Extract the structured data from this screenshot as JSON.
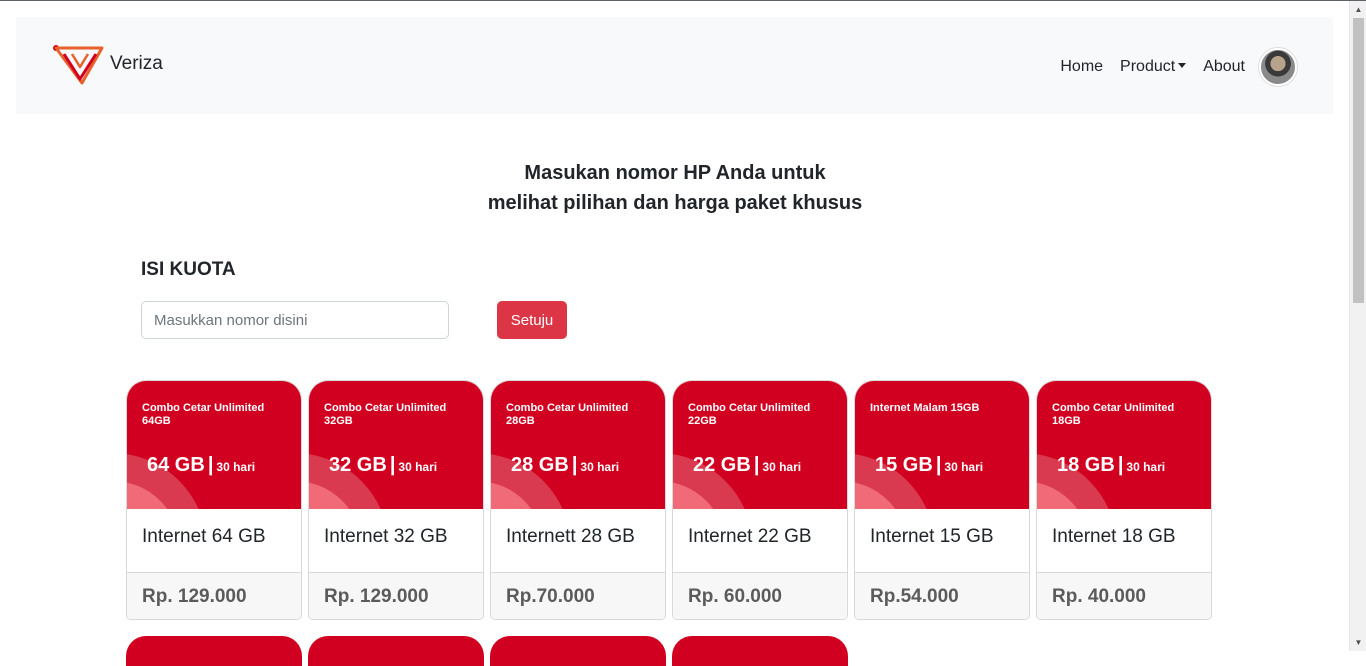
{
  "brand": {
    "name": "Veriza"
  },
  "nav": {
    "home": "Home",
    "product": "Product",
    "about": "About"
  },
  "headline": {
    "line1": "Masukan nomor HP Anda untuk",
    "line2": "melihat pilihan dan harga paket khusus"
  },
  "form": {
    "section_title": "ISI KUOTA",
    "input_placeholder": "Masukkan nomor disini",
    "input_value": "",
    "submit_label": "Setuju"
  },
  "cards": [
    {
      "name": "Combo Cetar Unlimited 64GB",
      "size": "64 GB",
      "duration": "30 hari",
      "title": "Internet 64 GB",
      "price": "Rp. 129.000"
    },
    {
      "name": "Combo Cetar Unlimited 32GB",
      "size": "32 GB",
      "duration": "30 hari",
      "title": "Internet 32 GB",
      "price": "Rp. 129.000"
    },
    {
      "name": "Combo Cetar Unlimited 28GB",
      "size": "28 GB",
      "duration": "30 hari",
      "title": "Internett 28 GB",
      "price": "Rp.70.000"
    },
    {
      "name": "Combo Cetar Unlimited 22GB",
      "size": "22 GB",
      "duration": "30 hari",
      "title": "Internet 22 GB",
      "price": "Rp. 60.000"
    },
    {
      "name": "Internet Malam 15GB",
      "size": "15 GB",
      "duration": "30 hari",
      "title": "Internet 15 GB",
      "price": "Rp.54.000"
    },
    {
      "name": "Combo Cetar Unlimited 18GB",
      "size": "18 GB",
      "duration": "30 hari",
      "title": "Internet 18 GB",
      "price": "Rp. 40.000"
    }
  ],
  "colors": {
    "accent": "#dc3545",
    "banner": "#d20020",
    "navbar_bg": "#f8f9fa"
  },
  "icons": {
    "logo": "veriza-logo-icon",
    "dropdown": "caret-down-icon",
    "avatar": "user-avatar"
  }
}
